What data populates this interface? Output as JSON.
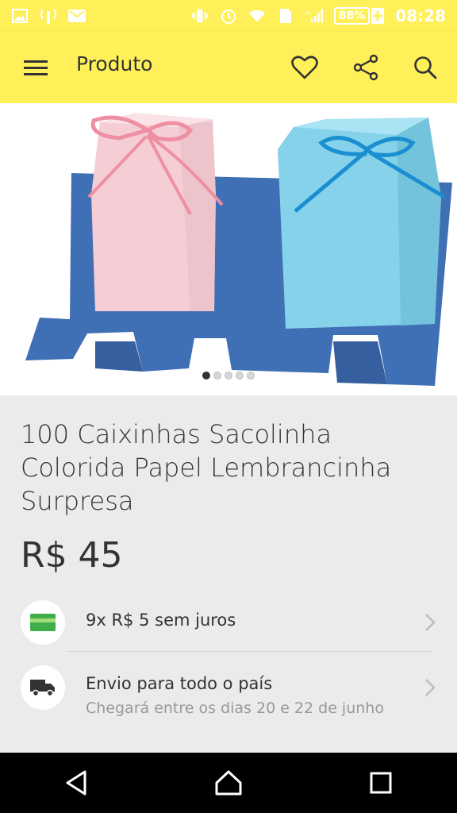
{
  "status_bar": {
    "battery": "88%",
    "time": "08:28",
    "colors": {
      "background": "#fff059",
      "icons": "#ffffff"
    },
    "icons": [
      "image-icon",
      "signal-icon",
      "mail-icon",
      "vibrate-icon",
      "alarm-icon",
      "wifi-icon",
      "sim-icon",
      "h-network-icon",
      "cell-signal-icon",
      "battery-icon"
    ]
  },
  "app_bar": {
    "title": "Produto",
    "icons": [
      "menu-icon",
      "heart-icon",
      "share-icon",
      "search-icon"
    ]
  },
  "gallery": {
    "image_count": 5,
    "active_index": 0
  },
  "product": {
    "title": "100 Caixinhas Sacolinha Colorida Papel Lembrancinha Surpresa",
    "price": "R$ 45",
    "installments": "9x R$ 5 sem juros",
    "shipping_title": "Envio para todo o país",
    "shipping_subtitle": "Chegará entre os dias 20 e 22 de junho"
  },
  "nav_bar": {
    "icons": [
      "back-icon",
      "home-icon",
      "recents-icon"
    ]
  }
}
